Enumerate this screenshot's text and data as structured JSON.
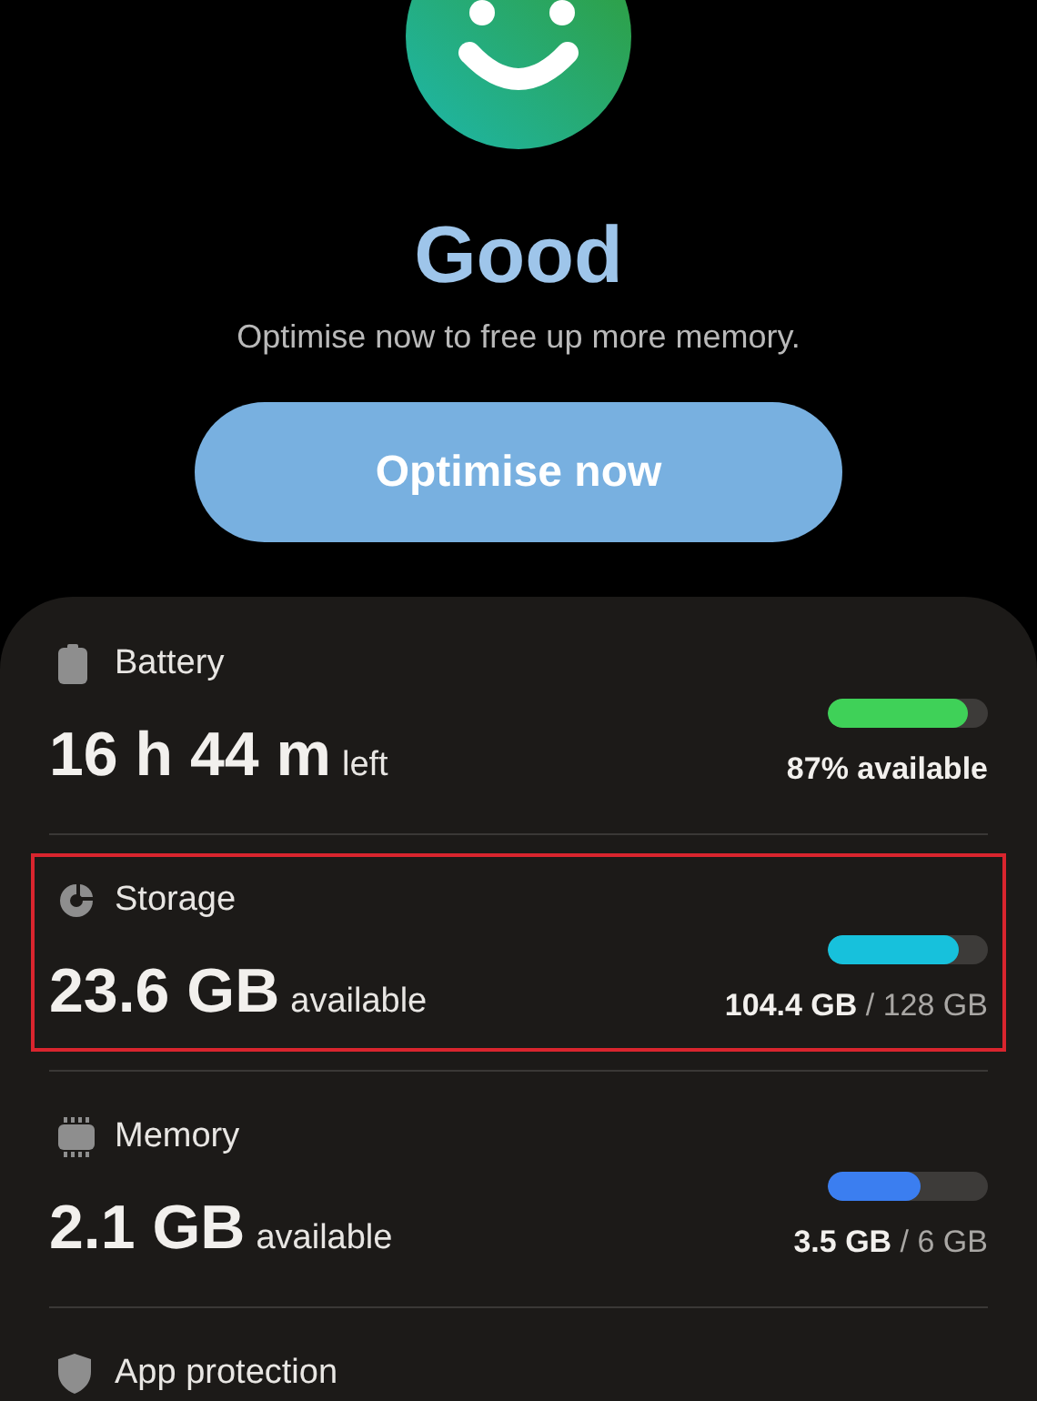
{
  "status": {
    "title": "Good",
    "message": "Optimise now to free up more memory."
  },
  "action": {
    "label": "Optimise now"
  },
  "items": [
    {
      "kind": "battery",
      "name": "Battery",
      "value": "16 h 44 m",
      "unit": "left",
      "level": 0.87,
      "color": "#3fd158",
      "reading": "**87% available**",
      "highlighted": false
    },
    {
      "kind": "storage",
      "name": "Storage",
      "value": "23.6 GB",
      "unit": "available",
      "level": 0.82,
      "color": "#17c1dc",
      "reading": "**104.4 GB** / 128 GB",
      "highlighted": true
    },
    {
      "kind": "memory",
      "name": "Memory",
      "value": "2.1 GB",
      "unit": "available",
      "level": 0.58,
      "color": "#3b7ef0",
      "reading": "**3.5 GB** / 6 GB",
      "highlighted": false
    },
    {
      "kind": "protection",
      "name": "App protection",
      "highlighted": false
    }
  ]
}
